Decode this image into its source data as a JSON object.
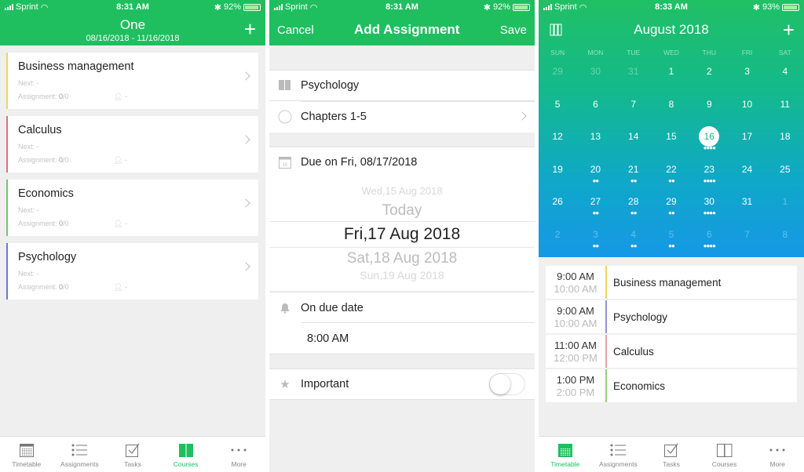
{
  "colors": {
    "brand_green": "#1fbf5f",
    "yellow": "#f3d35a",
    "red": "#e07078",
    "green": "#6ccb5f",
    "blue": "#6a78d6"
  },
  "panel1": {
    "status": {
      "carrier": "Sprint",
      "time": "8:31 AM",
      "battery": "92%"
    },
    "header": {
      "title": "One",
      "subtitle": "08/16/2018 - 11/16/2018",
      "add_icon": "plus-icon"
    },
    "courses": [
      {
        "name": "Business management",
        "next": "Next: -",
        "assign_label": "Assignment: ",
        "assign_done": "0",
        "assign_total": "/0",
        "teacher": "-"
      },
      {
        "name": "Calculus",
        "next": "Next: -",
        "assign_label": "Assignment: ",
        "assign_done": "0",
        "assign_total": "/0",
        "teacher": "-"
      },
      {
        "name": "Economics",
        "next": "Next: -",
        "assign_label": "Assignment: ",
        "assign_done": "0",
        "assign_total": "/0",
        "teacher": "-"
      },
      {
        "name": "Psychology",
        "next": "Next: -",
        "assign_label": "Assignment: ",
        "assign_done": "0",
        "assign_total": "/0",
        "teacher": "-"
      }
    ],
    "tabs": [
      {
        "label": "Timetable",
        "icon": "calendar-icon"
      },
      {
        "label": "Assignments",
        "icon": "list-icon"
      },
      {
        "label": "Tasks",
        "icon": "checkbox-icon"
      },
      {
        "label": "Courses",
        "icon": "book-icon",
        "active": true
      },
      {
        "label": "More",
        "icon": "more-icon"
      }
    ]
  },
  "panel2": {
    "status": {
      "carrier": "Sprint",
      "time": "8:31 AM",
      "battery": "92%"
    },
    "header": {
      "cancel": "Cancel",
      "title": "Add Assignment",
      "save": "Save"
    },
    "course": "Psychology",
    "assignment_name": "Chapters 1-5",
    "due": "Due on Fri, 08/17/2018",
    "picker": {
      "items": [
        "Wed,15 Aug 2018",
        "Today",
        "Fri,17 Aug 2018",
        "Sat,18 Aug 2018",
        "Sun,19 Aug 2018"
      ],
      "selected": "Fri,17 Aug 2018"
    },
    "reminder": "On due date",
    "reminder_time": "8:00 AM",
    "important_label": "Important",
    "important_on": false
  },
  "panel3": {
    "status": {
      "carrier": "Sprint",
      "time": "8:33 AM",
      "battery": "93%"
    },
    "header": {
      "title": "August 2018"
    },
    "weekdays": [
      "SUN",
      "MON",
      "TUE",
      "WED",
      "THU",
      "FRI",
      "SAT"
    ],
    "weeks": [
      [
        {
          "d": "29",
          "o": 1
        },
        {
          "d": "30",
          "o": 1
        },
        {
          "d": "31",
          "o": 1
        },
        {
          "d": "1"
        },
        {
          "d": "2"
        },
        {
          "d": "3"
        },
        {
          "d": "4"
        }
      ],
      [
        {
          "d": "5"
        },
        {
          "d": "6"
        },
        {
          "d": "7"
        },
        {
          "d": "8"
        },
        {
          "d": "9"
        },
        {
          "d": "10"
        },
        {
          "d": "11"
        }
      ],
      [
        {
          "d": "12"
        },
        {
          "d": "13"
        },
        {
          "d": "14"
        },
        {
          "d": "15"
        },
        {
          "d": "16",
          "today": 1,
          "dots": 4
        },
        {
          "d": "17"
        },
        {
          "d": "18"
        }
      ],
      [
        {
          "d": "19"
        },
        {
          "d": "20",
          "dots": 2
        },
        {
          "d": "21",
          "dots": 2
        },
        {
          "d": "22",
          "dots": 2
        },
        {
          "d": "23",
          "dots": 4
        },
        {
          "d": "24"
        },
        {
          "d": "25"
        }
      ],
      [
        {
          "d": "26"
        },
        {
          "d": "27",
          "dots": 2
        },
        {
          "d": "28",
          "dots": 2
        },
        {
          "d": "29",
          "dots": 2
        },
        {
          "d": "30",
          "dots": 4
        },
        {
          "d": "31"
        },
        {
          "d": "1",
          "o": 1
        }
      ],
      [
        {
          "d": "2",
          "o": 1
        },
        {
          "d": "3",
          "o": 1,
          "dots": 2
        },
        {
          "d": "4",
          "o": 1,
          "dots": 2
        },
        {
          "d": "5",
          "o": 1,
          "dots": 2
        },
        {
          "d": "6",
          "o": 1,
          "dots": 4
        },
        {
          "d": "7",
          "o": 1
        },
        {
          "d": "8",
          "o": 1
        }
      ]
    ],
    "events": [
      {
        "start": "9:00 AM",
        "end": "10:00 AM",
        "name": "Business management",
        "color": "#f3d35a"
      },
      {
        "start": "9:00 AM",
        "end": "10:00 AM",
        "name": "Psychology",
        "color": "#8f95d6"
      },
      {
        "start": "11:00 AM",
        "end": "12:00 PM",
        "name": "Calculus",
        "color": "#e8a0a6"
      },
      {
        "start": "1:00 PM",
        "end": "2:00 PM",
        "name": "Economics",
        "color": "#8fd27a"
      }
    ],
    "tabs": [
      {
        "label": "Timetable",
        "icon": "calendar-icon",
        "active": true
      },
      {
        "label": "Assignments",
        "icon": "list-icon"
      },
      {
        "label": "Tasks",
        "icon": "checkbox-icon"
      },
      {
        "label": "Courses",
        "icon": "book-icon"
      },
      {
        "label": "More",
        "icon": "more-icon"
      }
    ]
  }
}
